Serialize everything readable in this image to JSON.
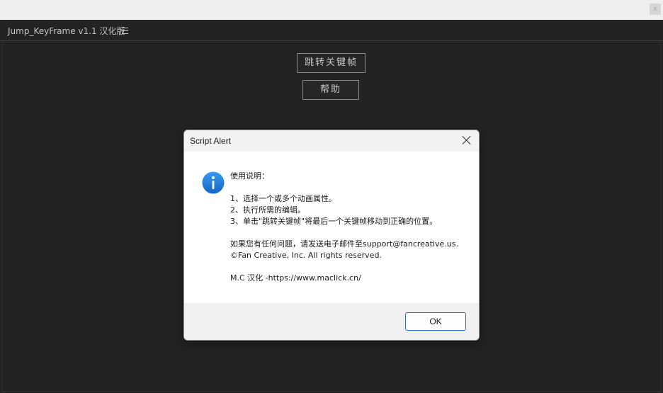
{
  "window": {
    "close_glyph": "x"
  },
  "panel": {
    "title": "Jump_KeyFrame v1.1 汉化版",
    "menu_icon": "hamburger-menu-icon"
  },
  "buttons": {
    "jump": "跳转关键帧",
    "help": "帮助"
  },
  "dialog": {
    "title": "Script Alert",
    "icon": "info-icon",
    "icon_color": "#1a7fd9",
    "lines": {
      "l0": "使用说明：",
      "l1": "",
      "l2": "1、选择一个或多个动画属性。",
      "l3": "2、执行所需的编辑。",
      "l4": "3、单击\"跳转关键帧\"将最后一个关键帧移动到正确的位置。",
      "l5": "",
      "l6": "如果您有任何问题，请发送电子邮件至support@fancreative.us.",
      "l7": " ©Fan Creative, Inc. All rights reserved.",
      "l8": "",
      "l9": "M.C 汉化 -https://www.maclick.cn/"
    },
    "ok_label": "OK"
  }
}
